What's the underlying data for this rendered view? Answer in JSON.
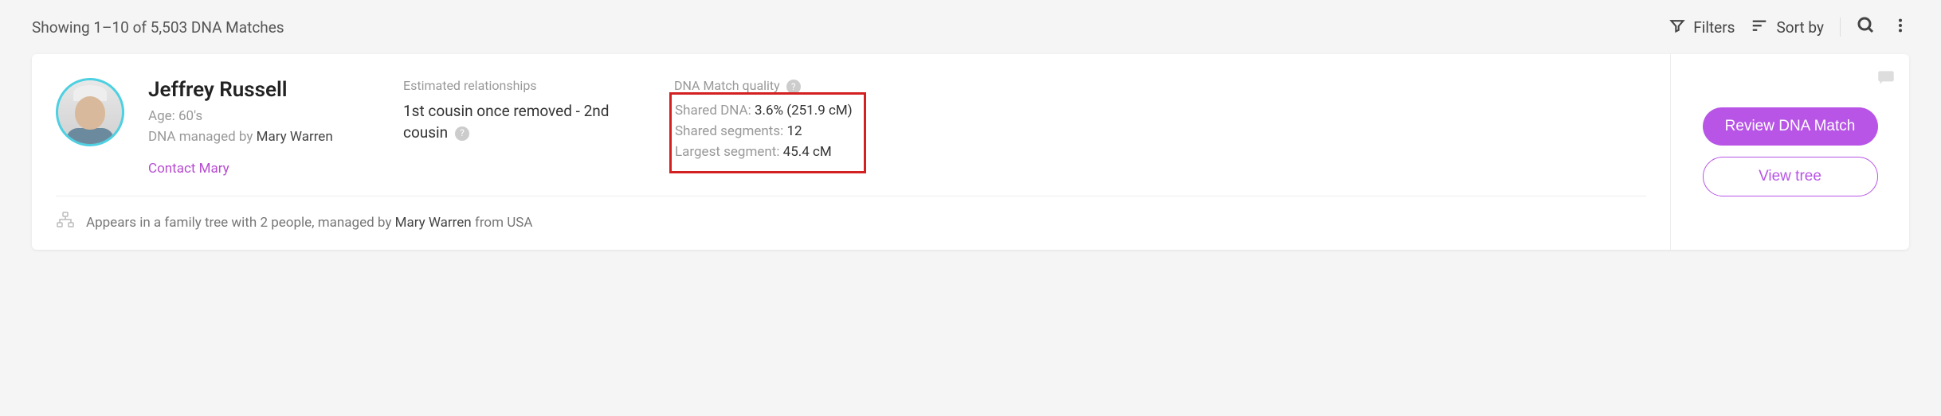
{
  "header": {
    "results_text": "Showing 1–10 of 5,503 DNA Matches",
    "filters_label": "Filters",
    "sort_label": "Sort by"
  },
  "match": {
    "name": "Jeffrey Russell",
    "age_label": "Age:",
    "age_value": "60's",
    "managed_by_label": "DNA managed by",
    "managed_by_name": "Mary Warren",
    "contact_label": "Contact Mary",
    "relationships": {
      "label": "Estimated relationships",
      "value": "1st cousin once removed - 2nd cousin"
    },
    "quality": {
      "label": "DNA Match quality",
      "shared_dna_label": "Shared DNA:",
      "shared_dna_value": "3.6% (251.9 cM)",
      "segments_label": "Shared segments:",
      "segments_value": "12",
      "largest_label": "Largest segment:",
      "largest_value": "45.4 cM"
    },
    "tree_info_prefix": "Appears in a family tree with 2 people, managed by",
    "tree_info_manager": "Mary Warren",
    "tree_info_suffix": "from USA"
  },
  "actions": {
    "review_label": "Review DNA Match",
    "view_tree_label": "View tree"
  }
}
